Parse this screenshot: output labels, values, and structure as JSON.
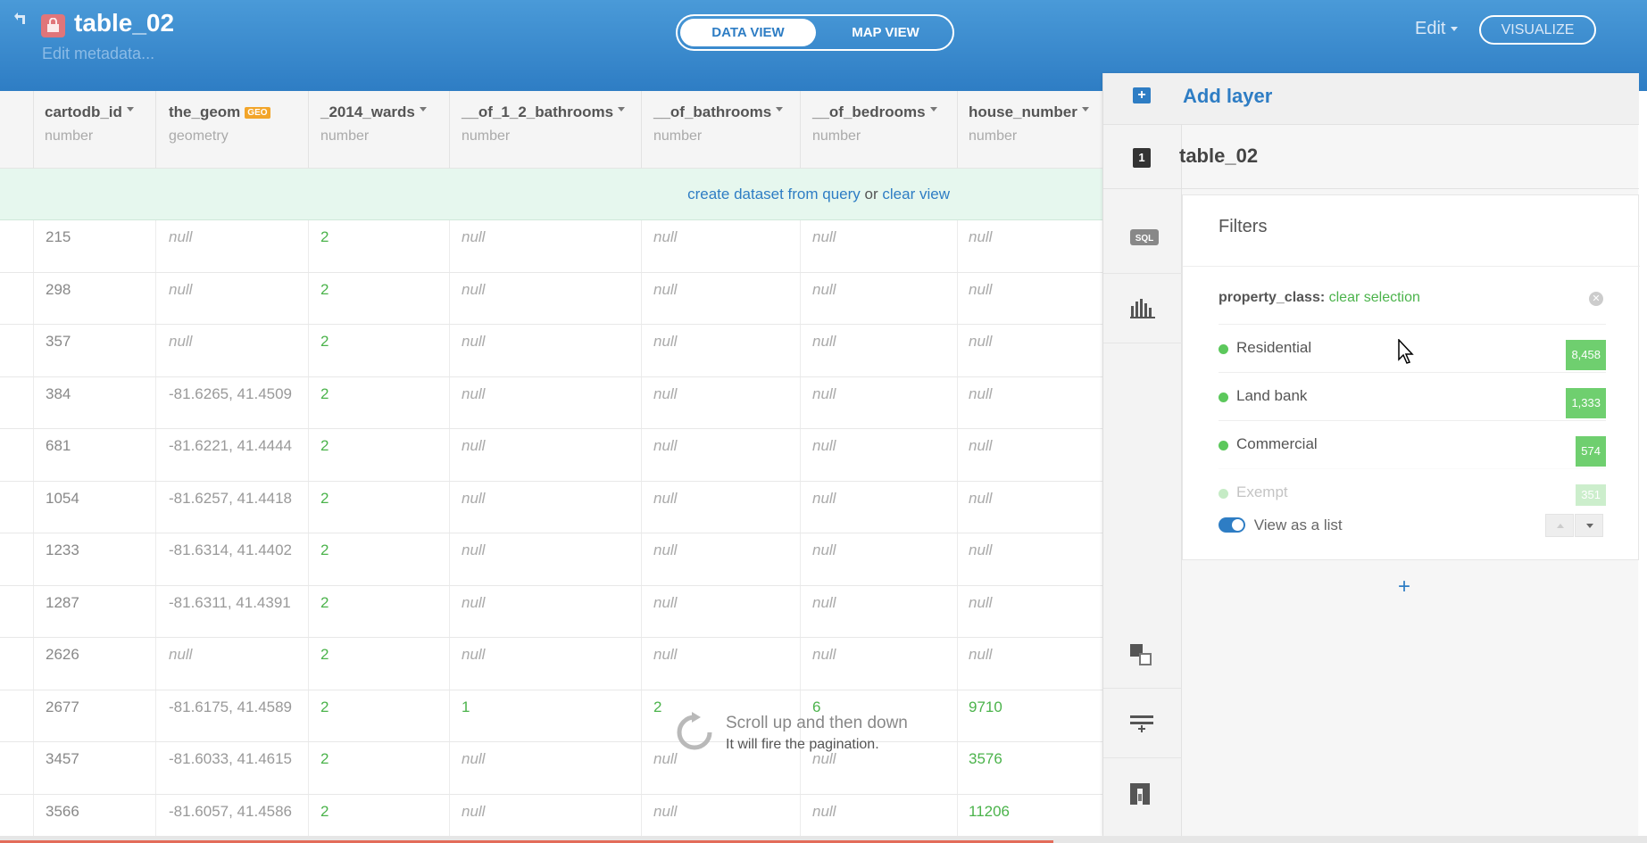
{
  "header": {
    "title": "table_02",
    "metadata_link": "Edit metadata...",
    "data_view_label": "DATA VIEW",
    "map_view_label": "MAP VIEW",
    "edit_label": "Edit",
    "visualize_label": "VISUALIZE"
  },
  "columns": [
    {
      "name": "cartodb_id",
      "type": "number"
    },
    {
      "name": "the_geom",
      "type": "geometry",
      "badge": "GEO"
    },
    {
      "name": "_2014_wards",
      "type": "number"
    },
    {
      "name": "__of_1_2_bathrooms",
      "type": "number"
    },
    {
      "name": "__of_bathrooms",
      "type": "number"
    },
    {
      "name": "__of_bedrooms",
      "type": "number"
    },
    {
      "name": "house_number",
      "type": "number"
    }
  ],
  "notice": {
    "create_link": "create dataset from query",
    "or_text": "or",
    "clear_link": "clear view"
  },
  "rows": [
    [
      "215",
      "null",
      "2",
      "null",
      "null",
      "null",
      "null"
    ],
    [
      "298",
      "null",
      "2",
      "null",
      "null",
      "null",
      "null"
    ],
    [
      "357",
      "null",
      "2",
      "null",
      "null",
      "null",
      "null"
    ],
    [
      "384",
      "-81.6265, 41.4509",
      "2",
      "null",
      "null",
      "null",
      "null"
    ],
    [
      "681",
      "-81.6221, 41.4444",
      "2",
      "null",
      "null",
      "null",
      "null"
    ],
    [
      "1054",
      "-81.6257, 41.4418",
      "2",
      "null",
      "null",
      "null",
      "null"
    ],
    [
      "1233",
      "-81.6314, 41.4402",
      "2",
      "null",
      "null",
      "null",
      "null"
    ],
    [
      "1287",
      "-81.6311, 41.4391",
      "2",
      "null",
      "null",
      "null",
      "null"
    ],
    [
      "2626",
      "null",
      "2",
      "null",
      "null",
      "null",
      "null"
    ],
    [
      "2677",
      "-81.6175, 41.4589",
      "2",
      "1",
      "2",
      "6",
      "9710"
    ],
    [
      "3457",
      "-81.6033, 41.4615",
      "2",
      "null",
      "null",
      "null",
      "3576"
    ],
    [
      "3566",
      "-81.6057, 41.4586",
      "2",
      "null",
      "null",
      "null",
      "11206"
    ]
  ],
  "pagination": {
    "line1": "Scroll up and then down",
    "line2": "It will fire the pagination."
  },
  "panel": {
    "add_layer_label": "Add layer",
    "layer_number": "1",
    "layer_name": "table_02",
    "sql_label": "SQL",
    "filters": {
      "title": "Filters",
      "property": "property_class:",
      "clear_selection": "clear selection",
      "categories": [
        {
          "label": "Residential",
          "count": "8,458"
        },
        {
          "label": "Land bank",
          "count": "1,333"
        },
        {
          "label": "Commercial",
          "count": "574"
        },
        {
          "label": "Exempt",
          "count": "351"
        }
      ],
      "view_as_list": "View as a list"
    },
    "add_plus": "+"
  },
  "colors": {
    "header_blue": "#2e7dc4",
    "green": "#4bb34b",
    "notice_bg": "#e6f7ee",
    "count_green": "#6fcf6f",
    "progress_red": "#e36c5a"
  }
}
